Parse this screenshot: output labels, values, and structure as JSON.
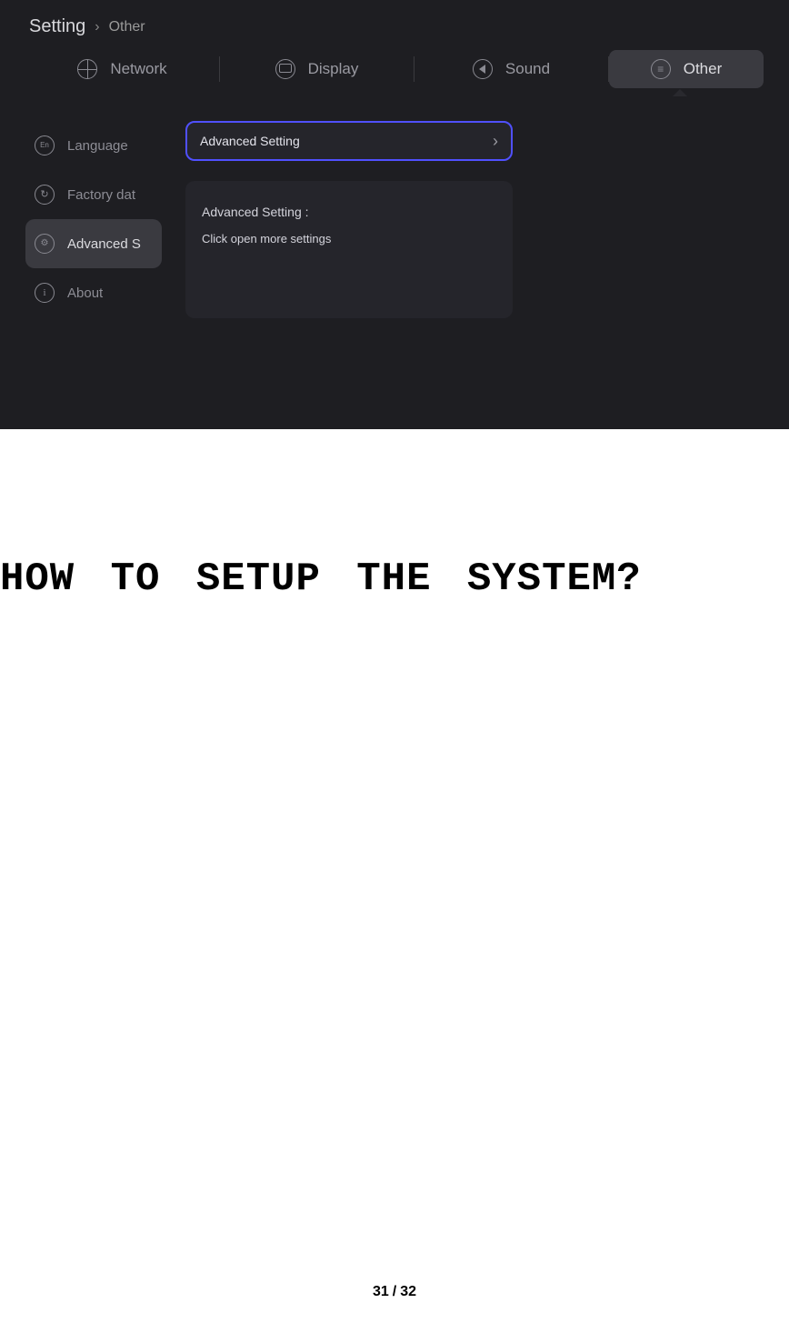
{
  "ui": {
    "breadcrumb": {
      "root": "Setting",
      "sub": "Other"
    },
    "tabs": {
      "network": "Network",
      "display": "Display",
      "sound": "Sound",
      "other": "Other"
    },
    "sidebar": {
      "language": "Language",
      "factory": "Factory dat",
      "advanced": "Advanced S",
      "about": "About"
    },
    "panel": {
      "row_label": "Advanced Setting",
      "desc_title": "Advanced Setting :",
      "desc_body": "Click open more settings"
    }
  },
  "doc": {
    "heading": "HOW TO SETUP THE SYSTEM?",
    "page_current": "31",
    "page_total": "32"
  }
}
